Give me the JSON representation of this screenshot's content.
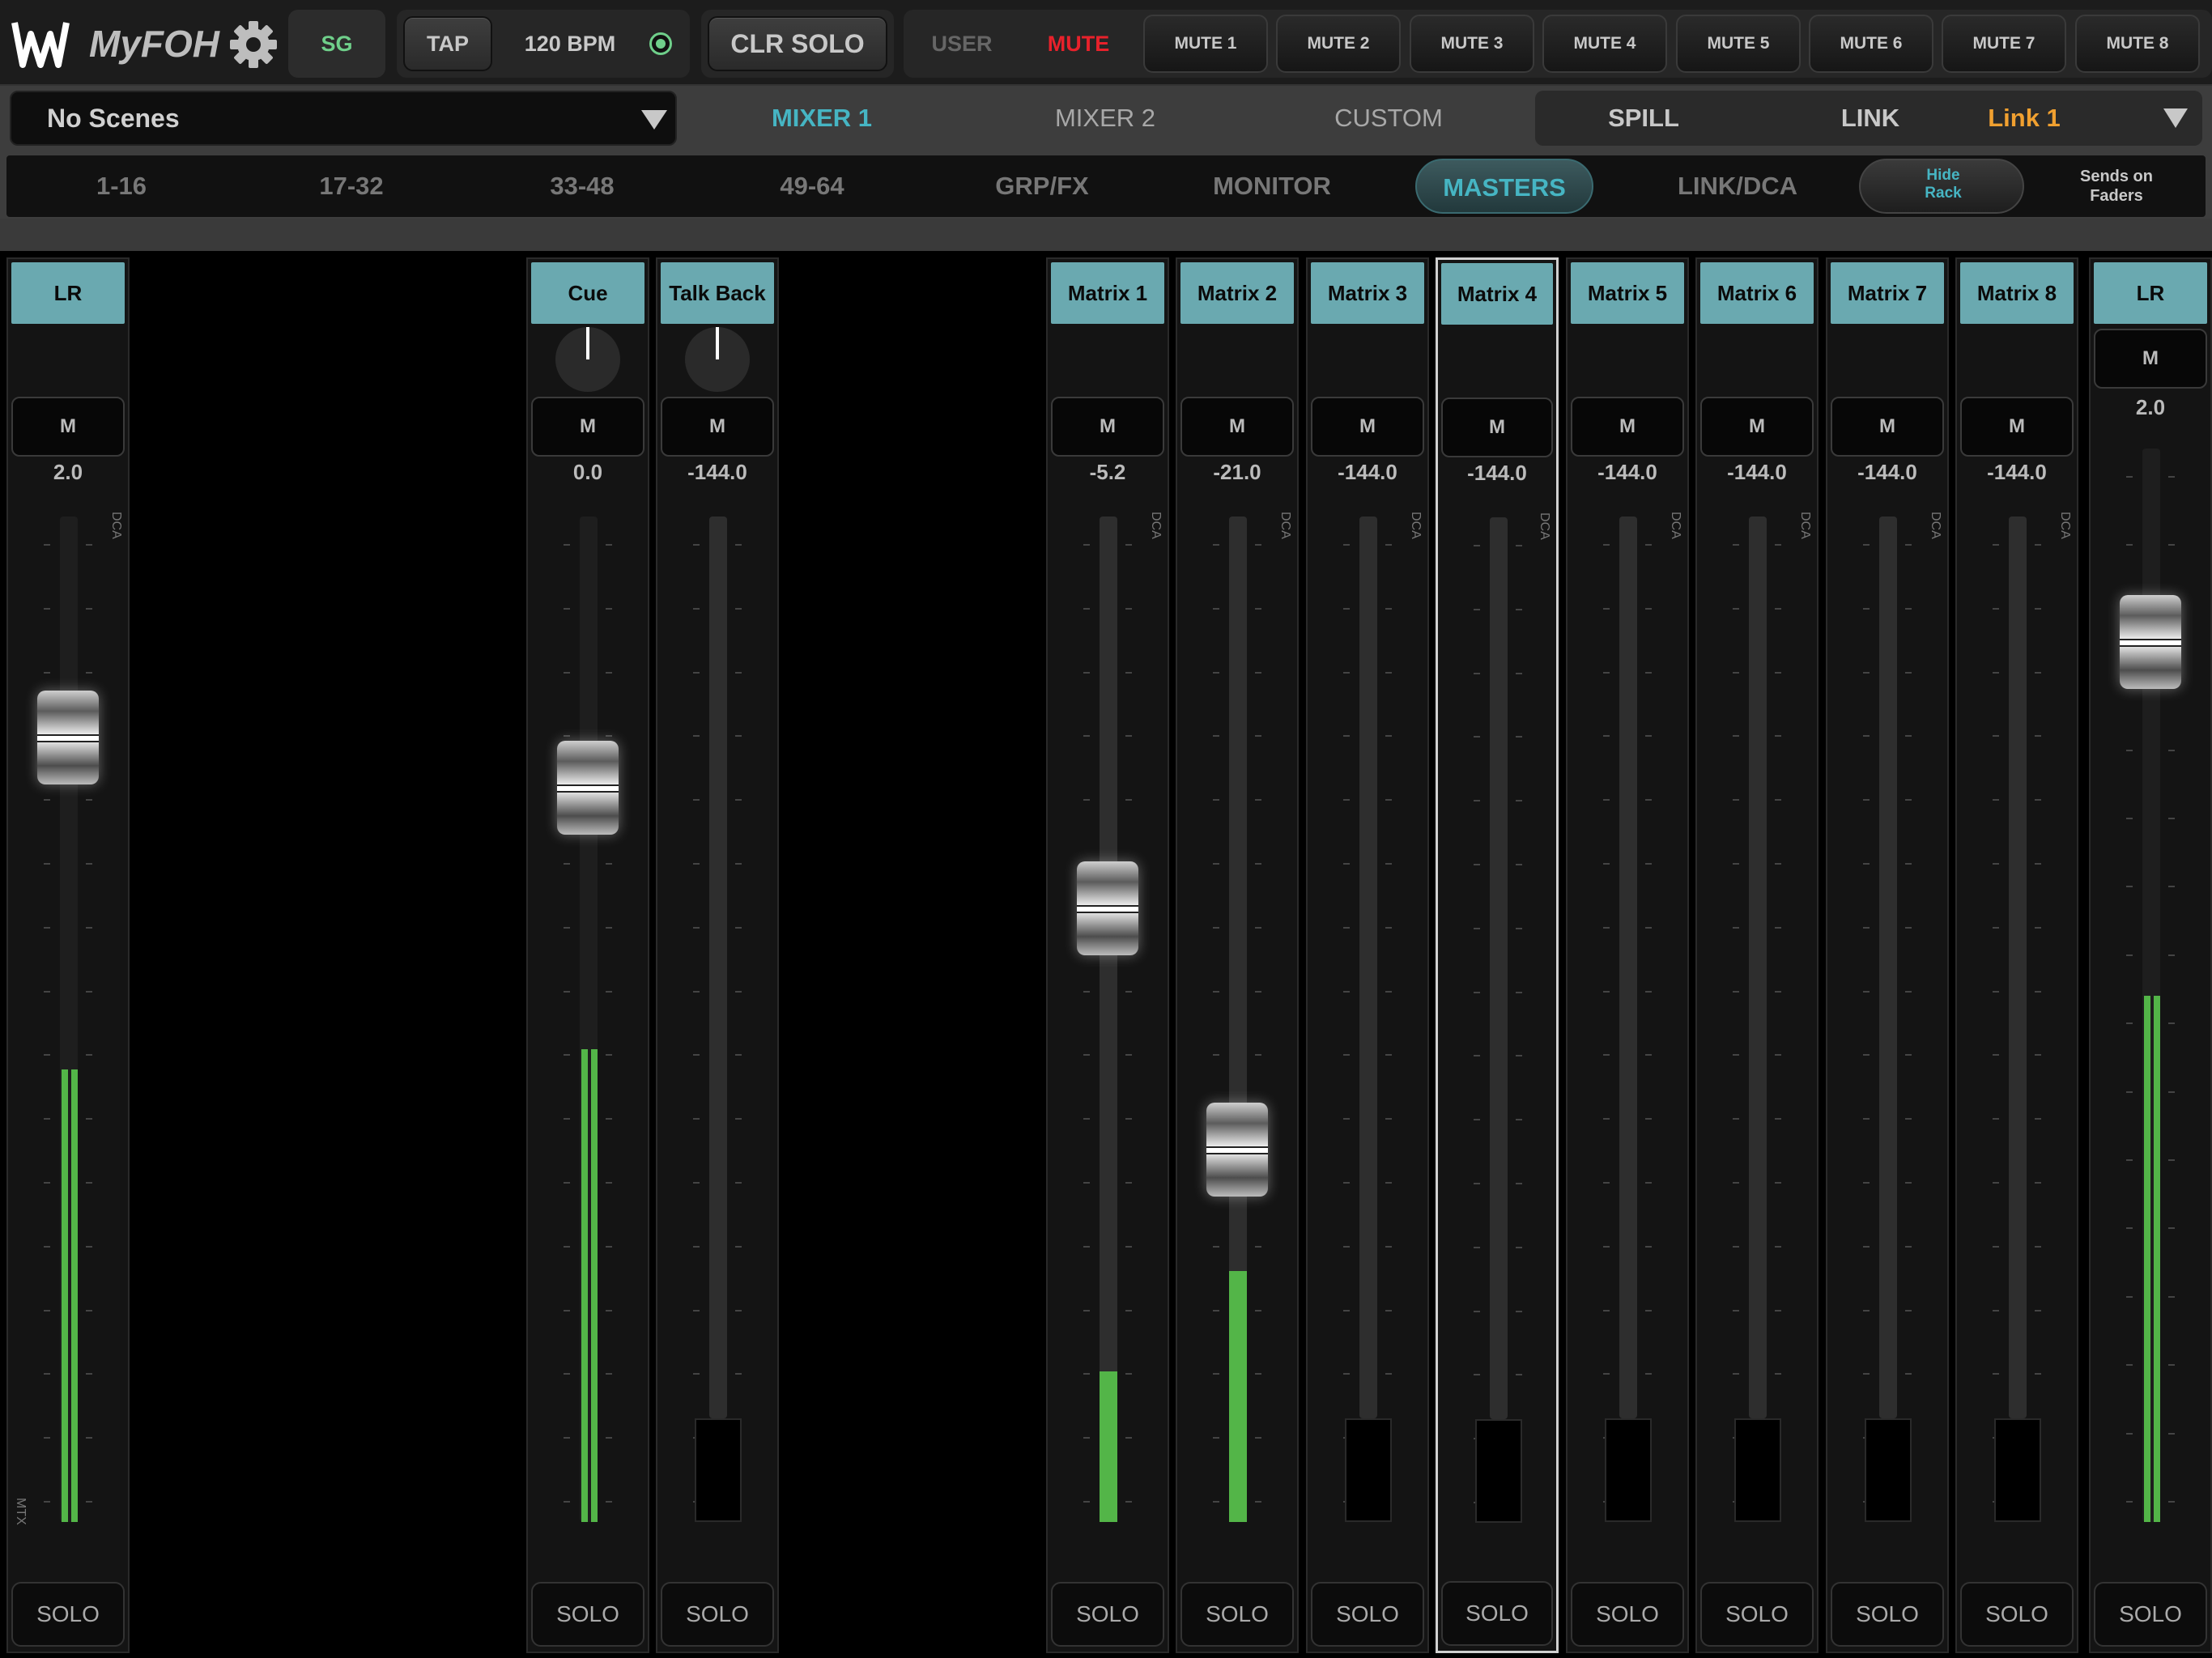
{
  "app": {
    "name": "MyFOH"
  },
  "topbar": {
    "sg": "SG",
    "tap": "TAP",
    "bpm": "120 BPM",
    "clr_solo": "CLR SOLO",
    "user": "USER",
    "mute": "MUTE",
    "mute_groups": [
      "MUTE 1",
      "MUTE 2",
      "MUTE 3",
      "MUTE 4",
      "MUTE 5",
      "MUTE 6",
      "MUTE 7",
      "MUTE 8"
    ]
  },
  "scenes": {
    "label": "No Scenes"
  },
  "mixers": {
    "mixer1": "MIXER 1",
    "mixer2": "MIXER 2",
    "custom": "CUSTOM"
  },
  "spill": {
    "spill": "SPILL",
    "link": "LINK",
    "link_value": "Link 1"
  },
  "banks": [
    "1-16",
    "17-32",
    "33-48",
    "49-64",
    "GRP/FX",
    "MONITOR",
    "MASTERS",
    "LINK/DCA"
  ],
  "hide_rack": "Hide Rack",
  "sends_on_faders": "Sends on Faders",
  "colors": {
    "accent": "#46b5c3",
    "mute_red": "#e8212b",
    "link_orange": "#f0a030",
    "label_bg": "#6aa9b0",
    "meter_green": "#53b548",
    "sg_green": "#6fcf8a"
  },
  "strips": [
    {
      "name": "LR",
      "mute": "M",
      "value": "2.0",
      "fader_level": 0.78,
      "meter_level": 0.45,
      "solo": "SOLO",
      "dca": "DCA",
      "mtx": "MTX"
    },
    {
      "name": "Cue",
      "mute": "M",
      "value": "0.0",
      "fader_level": 0.73,
      "meter_level": 0.47,
      "solo": "SOLO"
    },
    {
      "name": "Talk Back",
      "mute": "M",
      "value": "-144.0",
      "solo": "SOLO"
    },
    {
      "name": "Matrix 1",
      "mute": "M",
      "value": "-5.2",
      "fader_level": 0.61,
      "meter_level": 0.15,
      "solo": "SOLO",
      "dca": "DCA"
    },
    {
      "name": "Matrix 2",
      "mute": "M",
      "value": "-21.0",
      "fader_level": 0.37,
      "meter_level": 0.25,
      "solo": "SOLO",
      "dca": "DCA"
    },
    {
      "name": "Matrix 3",
      "mute": "M",
      "value": "-144.0",
      "solo": "SOLO",
      "dca": "DCA"
    },
    {
      "name": "Matrix 4",
      "mute": "M",
      "value": "-144.0",
      "solo": "SOLO",
      "dca": "DCA"
    },
    {
      "name": "Matrix 5",
      "mute": "M",
      "value": "-144.0",
      "solo": "SOLO",
      "dca": "DCA"
    },
    {
      "name": "Matrix 6",
      "mute": "M",
      "value": "-144.0",
      "solo": "SOLO",
      "dca": "DCA"
    },
    {
      "name": "Matrix 7",
      "mute": "M",
      "value": "-144.0",
      "solo": "SOLO",
      "dca": "DCA"
    },
    {
      "name": "Matrix 8",
      "mute": "M",
      "value": "-144.0",
      "solo": "SOLO",
      "dca": "DCA"
    },
    {
      "name": "LR",
      "mute": "M",
      "value": "2.0",
      "fader_level": 0.82,
      "meter_level": 0.49,
      "solo": "SOLO"
    }
  ]
}
